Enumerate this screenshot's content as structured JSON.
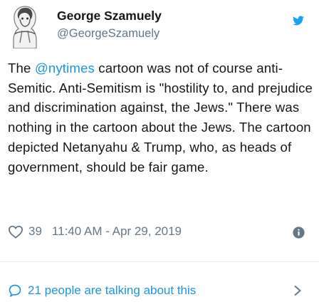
{
  "author": {
    "name": "George Szamuely",
    "handle": "@GeorgeSzamuely"
  },
  "tweet": {
    "text_before_mention": "The ",
    "mention": "@nytimes",
    "text_after_mention": " cartoon was not of course anti-Semitic. Anti-Semitism is \"hostility to, and prejudice and discrimination against, the Jews.\" There was nothing in the cartoon about the Jews. The cartoon depicted Netanyahu & Trump, who, as heads of government, should be fair game."
  },
  "meta": {
    "like_count": "39",
    "timestamp": "11:40 AM - Apr 29, 2019"
  },
  "conversation": {
    "label": "21 people are talking about this"
  },
  "icons": {
    "brand": "twitter-bird-icon",
    "like": "heart-icon",
    "info": "info-icon",
    "reply": "reply-bubble-icon",
    "chevron": "chevron-right-icon"
  },
  "colors": {
    "accent": "#1b95e0",
    "muted": "#657786",
    "text": "#14171a"
  }
}
